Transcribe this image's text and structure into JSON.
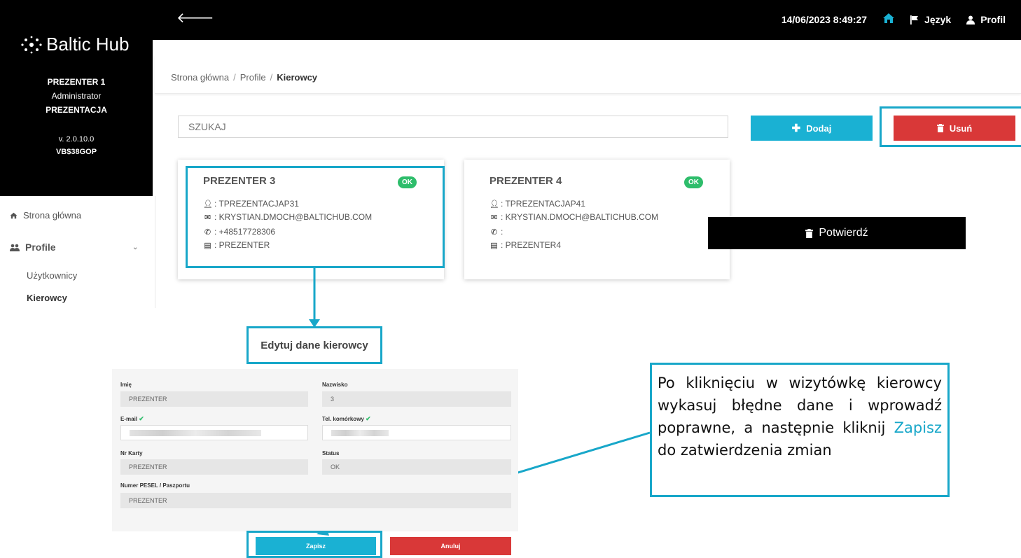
{
  "topbar": {
    "datetime": "14/06/2023 8:49:27",
    "language_label": "Język",
    "profile_label": "Profil"
  },
  "sidebar": {
    "logo_text": "Baltic Hub",
    "user_name": "PREZENTER 1",
    "user_role": "Administrator",
    "company": "PREZENTACJA",
    "version": "v. 2.0.10.0",
    "code": "VB$38GOP",
    "nav": {
      "home": "Strona główna",
      "profile": "Profile",
      "users": "Użytkownicy",
      "drivers": "Kierowcy"
    }
  },
  "breadcrumb": {
    "home": "Strona główna",
    "profile": "Profile",
    "current": "Kierowcy",
    "separator": "/"
  },
  "search": {
    "placeholder": "SZUKAJ"
  },
  "buttons": {
    "add": "Dodaj",
    "delete": "Usuń",
    "confirm": "Potwierdź"
  },
  "cards": [
    {
      "name": "PREZENTER 3",
      "status": "OK",
      "login": ": TPREZENTACJAP31",
      "email": ": KRYSTIAN.DMOCH@BALTICHUB.COM",
      "phone": ": +48517728306",
      "card": ": PREZENTER"
    },
    {
      "name": "PREZENTER 4",
      "status": "OK",
      "login": ": TPREZENTACJAP41",
      "email": ": KRYSTIAN.DMOCH@BALTICHUB.COM",
      "phone": ":",
      "card": ": PREZENTER4"
    }
  ],
  "edit_form": {
    "title": "Edytuj dane kierowcy",
    "first_name_label": "Imię",
    "first_name_value": "PREZENTER",
    "last_name_label": "Nazwisko",
    "last_name_value": "3",
    "email_label": "E-mail",
    "phone_label": "Tel. komórkowy",
    "card_label": "Nr Karty",
    "card_value": "PREZENTER",
    "status_label": "Status",
    "status_value": "OK",
    "pesel_label": "Numer PESEL / Paszportu",
    "pesel_value": "PREZENTER",
    "save": "Zapisz",
    "cancel": "Anuluj"
  },
  "instruction": {
    "before": "Po kliknięciu w wizytówkę kierowcy wykasuj błędne dane i wprowadź poprawne, a następnie kliknij ",
    "highlight": "Zapisz",
    "after": " do zatwierdzenia zmian"
  },
  "colors": {
    "accent": "#18a7c9",
    "add_button": "#1ab1d3",
    "danger": "#d93838",
    "ok_badge": "#2ebd6b"
  }
}
